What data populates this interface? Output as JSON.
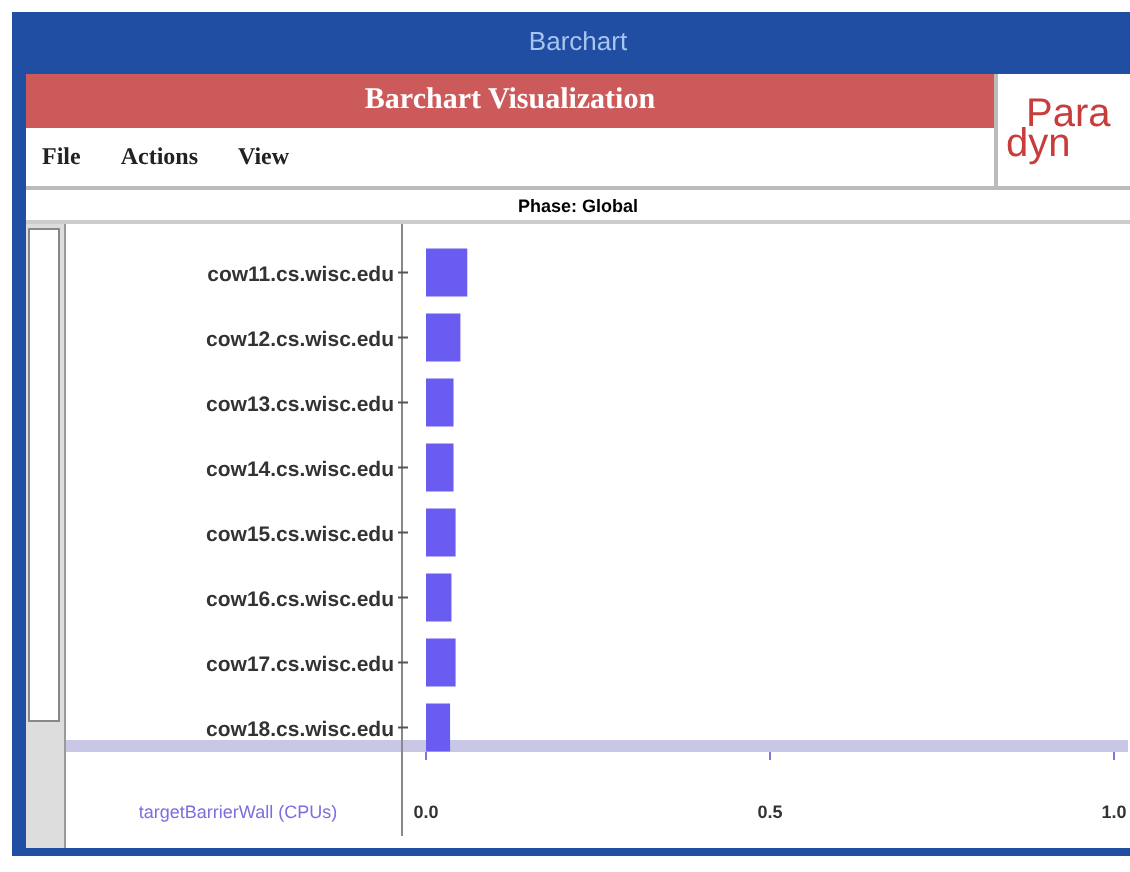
{
  "window": {
    "title": "Barchart"
  },
  "banner": {
    "title": "Barchart Visualization"
  },
  "logo": {
    "top": "Para",
    "bottom": "dyn"
  },
  "menu": [
    "File",
    "Actions",
    "View"
  ],
  "phase": "Phase: Global",
  "chart": {
    "chart_data": {
      "type": "bar",
      "orientation": "horizontal",
      "xlabel": "targetBarrierWall (CPUs)",
      "categories": [
        "cow11.cs.wisc.edu",
        "cow12.cs.wisc.edu",
        "cow13.cs.wisc.edu",
        "cow14.cs.wisc.edu",
        "cow15.cs.wisc.edu",
        "cow16.cs.wisc.edu",
        "cow17.cs.wisc.edu",
        "cow18.cs.wisc.edu"
      ],
      "series": [
        {
          "color": "#6a5cf0",
          "values": [
            0.06,
            0.05,
            0.04,
            0.04,
            0.043,
            0.037,
            0.043,
            0.035
          ]
        }
      ],
      "xlim": [
        0,
        1
      ],
      "xticks": [
        {
          "value": 0,
          "label": "0.0"
        },
        {
          "value": 0.5,
          "label": "0.5"
        },
        {
          "value": 1,
          "label": "1.0"
        }
      ]
    }
  }
}
